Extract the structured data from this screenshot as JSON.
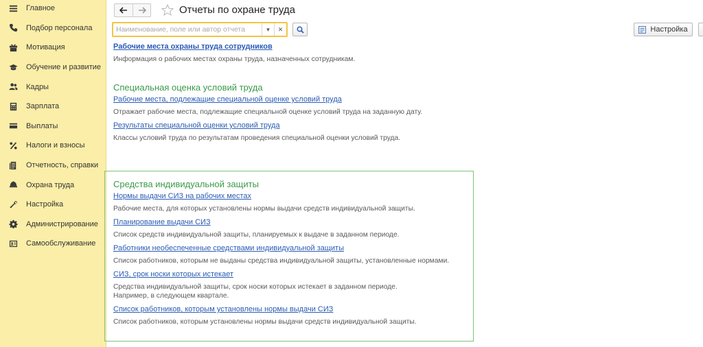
{
  "sidebar": {
    "items": [
      {
        "label": "Главное",
        "icon": "menu-icon"
      },
      {
        "label": "Подбор персонала",
        "icon": "phone-icon"
      },
      {
        "label": "Мотивация",
        "icon": "gift-icon"
      },
      {
        "label": "Обучение и развитие",
        "icon": "graduation-icon"
      },
      {
        "label": "Кадры",
        "icon": "people-icon"
      },
      {
        "label": "Зарплата",
        "icon": "calculator-icon"
      },
      {
        "label": "Выплаты",
        "icon": "wallet-icon"
      },
      {
        "label": "Налоги и взносы",
        "icon": "percent-icon"
      },
      {
        "label": "Отчетность, справки",
        "icon": "report-icon"
      },
      {
        "label": "Охрана труда",
        "icon": "helmet-icon"
      },
      {
        "label": "Настройка",
        "icon": "wrench-icon"
      },
      {
        "label": "Администрирование",
        "icon": "gear-icon"
      },
      {
        "label": "Самообслуживание",
        "icon": "id-card-icon"
      }
    ]
  },
  "header": {
    "title": "Отчеты по охране труда",
    "search_placeholder": "Наименование, поле или автор отчета",
    "settings_label": "Настройка"
  },
  "sections": [
    {
      "title": "",
      "items": [
        {
          "link": "Рабочие места охраны труда сотрудников",
          "desc": "Информация о рабочих местах охраны труда, назначенных сотрудникам."
        }
      ]
    },
    {
      "title": "Специальная оценка условий труда",
      "items": [
        {
          "link": "Рабочие места, подлежащие специальной оценке условий труда",
          "desc": "Отражает рабочие места, подлежащие специальной оценке условий труда на заданную дату."
        },
        {
          "link": "Результаты специальной оценки условий труда",
          "desc": "Классы условий труда по результатам проведения специальной оценки условий труда."
        }
      ]
    },
    {
      "title": "Средства индивидуальной защиты",
      "items": [
        {
          "link": "Нормы выдачи СИЗ на рабочих местах",
          "desc": "Рабочие места, для которых установлены нормы выдачи средств индивидуальной защиты."
        },
        {
          "link": "Планирование выдачи СИЗ",
          "desc": "Список средств индивидуальной защиты, планируемых к выдаче в заданном периоде."
        },
        {
          "link": "Работники необеспеченные средствами индивидуальной защиты",
          "desc": "Список работников, которым не выданы средства индивидуальной защиты, установленные нормами."
        },
        {
          "link": "СИЗ, срок носки которых истекает",
          "desc": "Средства индивидуальной защиты, срок носки которых истекает в заданном периоде.",
          "desc2": "Например, в следующем квартале."
        },
        {
          "link": "Список работников, которым установлены нормы выдачи СИЗ",
          "desc": "Список работников, которым установлены нормы выдачи средств индивидуальной защиты."
        }
      ]
    }
  ],
  "colors": {
    "sidebar_bg": "#fbeea8",
    "link": "#2a5cb4",
    "section_title": "#3a9a4a",
    "search_border": "#f3c443",
    "box_border": "#7dc37d"
  }
}
